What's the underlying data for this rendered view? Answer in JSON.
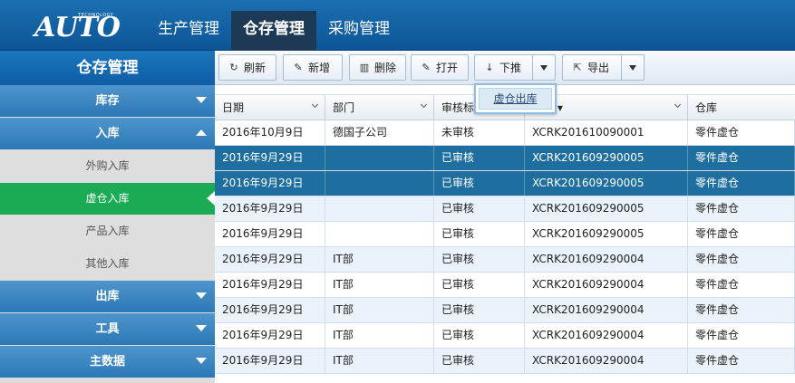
{
  "header": {
    "logo_text": "AUTO",
    "logo_small": "TECHNOLOGY",
    "nav": [
      "生产管理",
      "仓存管理",
      "采购管理"
    ],
    "active_nav": 1
  },
  "sidebar": {
    "title": "仓存管理",
    "groups": [
      {
        "label": "库存",
        "expanded": false
      },
      {
        "label": "入库",
        "expanded": true,
        "items": [
          "外购入库",
          "虚仓入库",
          "产品入库",
          "其他入库"
        ],
        "active_item": 1
      },
      {
        "label": "出库",
        "expanded": false
      },
      {
        "label": "工具",
        "expanded": false
      },
      {
        "label": "主数据",
        "expanded": false
      }
    ]
  },
  "toolbar": {
    "refresh": "刷新",
    "add": "新增",
    "delete": "删除",
    "open": "打开",
    "push_down": "下推",
    "export": "导出"
  },
  "dropdown": {
    "item": "虚仓出库"
  },
  "grid": {
    "columns": [
      "日期",
      "部门",
      "审核标",
      "编号 ▾",
      "仓库"
    ],
    "rows": [
      {
        "date": "2016年10月9日",
        "dept": "德国子公司",
        "status": "未审核",
        "code": "XCRK201610090001",
        "wh": "零件虚仓"
      },
      {
        "date": "2016年9月29日",
        "dept": "",
        "status": "已审核",
        "code": "XCRK201609290005",
        "wh": "零件虚仓"
      },
      {
        "date": "2016年9月29日",
        "dept": "",
        "status": "已审核",
        "code": "XCRK201609290005",
        "wh": "零件虚仓"
      },
      {
        "date": "2016年9月29日",
        "dept": "",
        "status": "已审核",
        "code": "XCRK201609290005",
        "wh": "零件虚仓"
      },
      {
        "date": "2016年9月29日",
        "dept": "",
        "status": "已审核",
        "code": "XCRK201609290005",
        "wh": "零件虚仓"
      },
      {
        "date": "2016年9月29日",
        "dept": "IT部",
        "status": "已审核",
        "code": "XCRK201609290004",
        "wh": "零件虚仓"
      },
      {
        "date": "2016年9月29日",
        "dept": "IT部",
        "status": "已审核",
        "code": "XCRK201609290004",
        "wh": "零件虚仓"
      },
      {
        "date": "2016年9月29日",
        "dept": "IT部",
        "status": "已审核",
        "code": "XCRK201609290004",
        "wh": "零件虚仓"
      },
      {
        "date": "2016年9月29日",
        "dept": "IT部",
        "status": "已审核",
        "code": "XCRK201609290004",
        "wh": "零件虚仓"
      },
      {
        "date": "2016年9月29日",
        "dept": "IT部",
        "status": "已审核",
        "code": "XCRK201609290004",
        "wh": "零件虚仓"
      }
    ],
    "selected_rows": [
      1,
      2
    ]
  }
}
